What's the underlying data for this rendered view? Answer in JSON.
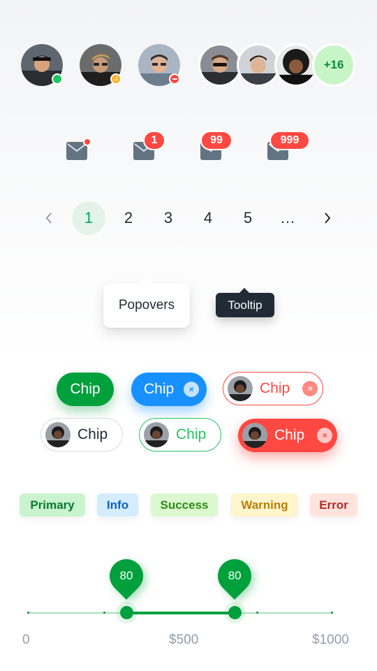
{
  "avatars": {
    "single": [
      {
        "status": "online"
      },
      {
        "status": "away"
      },
      {
        "status": "busy"
      }
    ],
    "group_more": "+16"
  },
  "badges": {
    "items": [
      {
        "type": "dot",
        "value": ""
      },
      {
        "type": "count",
        "value": "1"
      },
      {
        "type": "count",
        "value": "99"
      },
      {
        "type": "count",
        "value": "999"
      }
    ],
    "icon": "mail-icon"
  },
  "pagination": {
    "pages": [
      "1",
      "2",
      "3",
      "4",
      "5",
      "…"
    ],
    "active_page": "1"
  },
  "popover": {
    "label": "Popovers"
  },
  "tooltip": {
    "label": "Tooltip"
  },
  "chips": {
    "row1": [
      "Chip",
      "Chip",
      "Chip"
    ],
    "row2": [
      "Chip",
      "Chip",
      "Chip"
    ]
  },
  "labels": [
    "Primary",
    "Info",
    "Success",
    "Warning",
    "Error"
  ],
  "slider": {
    "min_label": "0",
    "mid_label": "$500",
    "max_label": "$1000",
    "value_low": "80",
    "value_high": "80",
    "range_fraction": [
      0.325,
      0.68
    ]
  },
  "colors": {
    "primary": "#00a03c",
    "info": "#1890ff",
    "error": "#ff4842",
    "dark": "#212b36"
  }
}
